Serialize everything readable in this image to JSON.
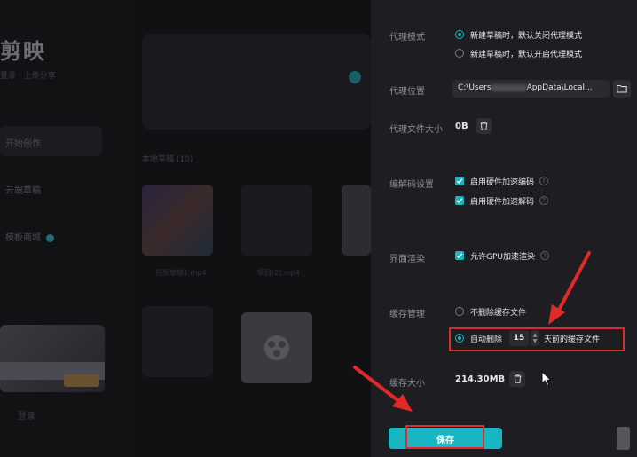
{
  "background": {
    "logo": "剪映",
    "subtitle": "登录 · 上传分享",
    "nav": [
      "开始创作",
      "云端草稿",
      "模板商城"
    ],
    "user": "登录",
    "drafts_label": "本地草稿 (10)",
    "captions": [
      "视频草稿1.mp4",
      "项目(2).mp4"
    ]
  },
  "settings": {
    "proxy_mode": {
      "label": "代理模式",
      "options": [
        "新建草稿时，默认关闭代理模式",
        "新建草稿时，默认开启代理模式"
      ],
      "selected": 0
    },
    "proxy_location": {
      "label": "代理位置",
      "path_start": "C:\\Users",
      "path_end": "AppData\\Local..."
    },
    "proxy_size": {
      "label": "代理文件大小",
      "value": "0B"
    },
    "codec": {
      "label": "编解码设置",
      "options": [
        "启用硬件加速编码",
        "启用硬件加速解码"
      ]
    },
    "render": {
      "label": "界面渲染",
      "option": "允许GPU加速渲染"
    },
    "cache": {
      "label": "缓存管理",
      "opt_none": "不删除缓存文件",
      "opt_auto": "自动删除",
      "days": "15",
      "suffix": "天前的缓存文件"
    },
    "cache_size": {
      "label": "缓存大小",
      "value": "214.30MB"
    },
    "save_label": "保存"
  },
  "colors": {
    "accent": "#18b5c2",
    "annotation": "#e02a2a",
    "panel": "#1e1e22"
  }
}
